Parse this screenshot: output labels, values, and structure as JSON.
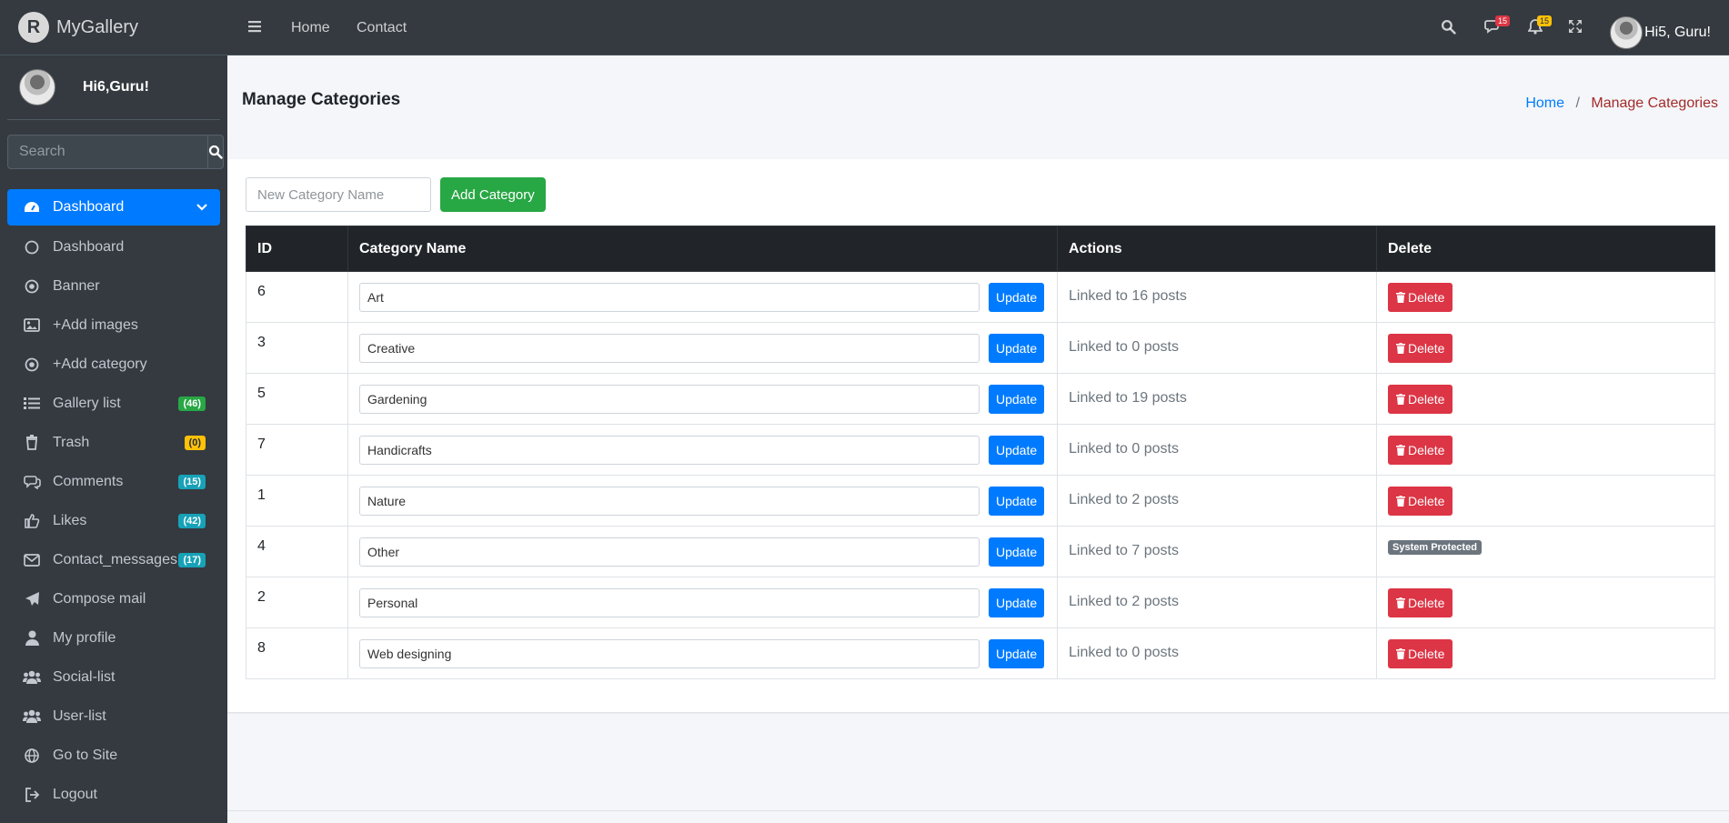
{
  "brand": {
    "name": "MyGallery",
    "logo_letter": "R"
  },
  "sidebar": {
    "user_name": "Hi6,Guru!",
    "search_placeholder": "Search",
    "items": [
      {
        "label": "Dashboard",
        "icon": "tachometer-icon",
        "active": true
      },
      {
        "label": "Dashboard",
        "icon": "circle-icon"
      },
      {
        "label": "Banner",
        "icon": "dot-circle-icon"
      },
      {
        "label": "+Add images",
        "icon": "image-icon"
      },
      {
        "label": "+Add category",
        "icon": "dot-circle-icon"
      },
      {
        "label": "Gallery list",
        "icon": "list-icon",
        "badge": "(46)",
        "badge_color": "#28a745"
      },
      {
        "label": "Trash",
        "icon": "trash-icon",
        "badge": "(0)",
        "badge_color": "#ffc107"
      },
      {
        "label": "Comments",
        "icon": "comments-icon",
        "badge": "(15)",
        "badge_color": "#17a2b8"
      },
      {
        "label": "Likes",
        "icon": "thumbs-up-icon",
        "badge": "(42)",
        "badge_color": "#17a2b8"
      },
      {
        "label": "Contact_messages",
        "icon": "envelope-icon",
        "badge": "(17)",
        "badge_color": "#17a2b8"
      },
      {
        "label": "Compose mail",
        "icon": "paper-plane-icon"
      },
      {
        "label": "My profile",
        "icon": "user-icon"
      },
      {
        "label": "Social-list",
        "icon": "users-icon"
      },
      {
        "label": "User-list",
        "icon": "users-icon"
      },
      {
        "label": "Go to Site",
        "icon": "globe-icon"
      },
      {
        "label": "Logout",
        "icon": "sign-out-icon"
      }
    ]
  },
  "topbar": {
    "links": [
      "Home",
      "Contact"
    ],
    "messages_count": "15",
    "notifications_count": "15",
    "user_greeting": "Hi5, Guru!",
    "colors": {
      "messages_badge": "#dc3545",
      "notifications_badge": "#ffc107"
    }
  },
  "header": {
    "title": "Manage Categories",
    "breadcrumb": {
      "home": "Home",
      "current": "Manage Categories"
    }
  },
  "form": {
    "placeholder": "New Category Name",
    "add_label": "Add Category"
  },
  "table": {
    "headers": [
      "ID",
      "Category Name",
      "Actions",
      "Delete"
    ],
    "update_label": "Update",
    "delete_label": "Delete",
    "protected_label": "System Protected",
    "rows": [
      {
        "id": "6",
        "name": "Art",
        "linked": "Linked to 16 posts",
        "protected": false
      },
      {
        "id": "3",
        "name": "Creative",
        "linked": "Linked to 0 posts",
        "protected": false
      },
      {
        "id": "5",
        "name": "Gardening",
        "linked": "Linked to 19 posts",
        "protected": false
      },
      {
        "id": "7",
        "name": "Handicrafts",
        "linked": "Linked to 0 posts",
        "protected": false
      },
      {
        "id": "1",
        "name": "Nature",
        "linked": "Linked to 2 posts",
        "protected": false
      },
      {
        "id": "4",
        "name": "Other",
        "linked": "Linked to 7 posts",
        "protected": true
      },
      {
        "id": "2",
        "name": "Personal",
        "linked": "Linked to 2 posts",
        "protected": false
      },
      {
        "id": "8",
        "name": "Web designing",
        "linked": "Linked to 0 posts",
        "protected": false
      }
    ]
  }
}
